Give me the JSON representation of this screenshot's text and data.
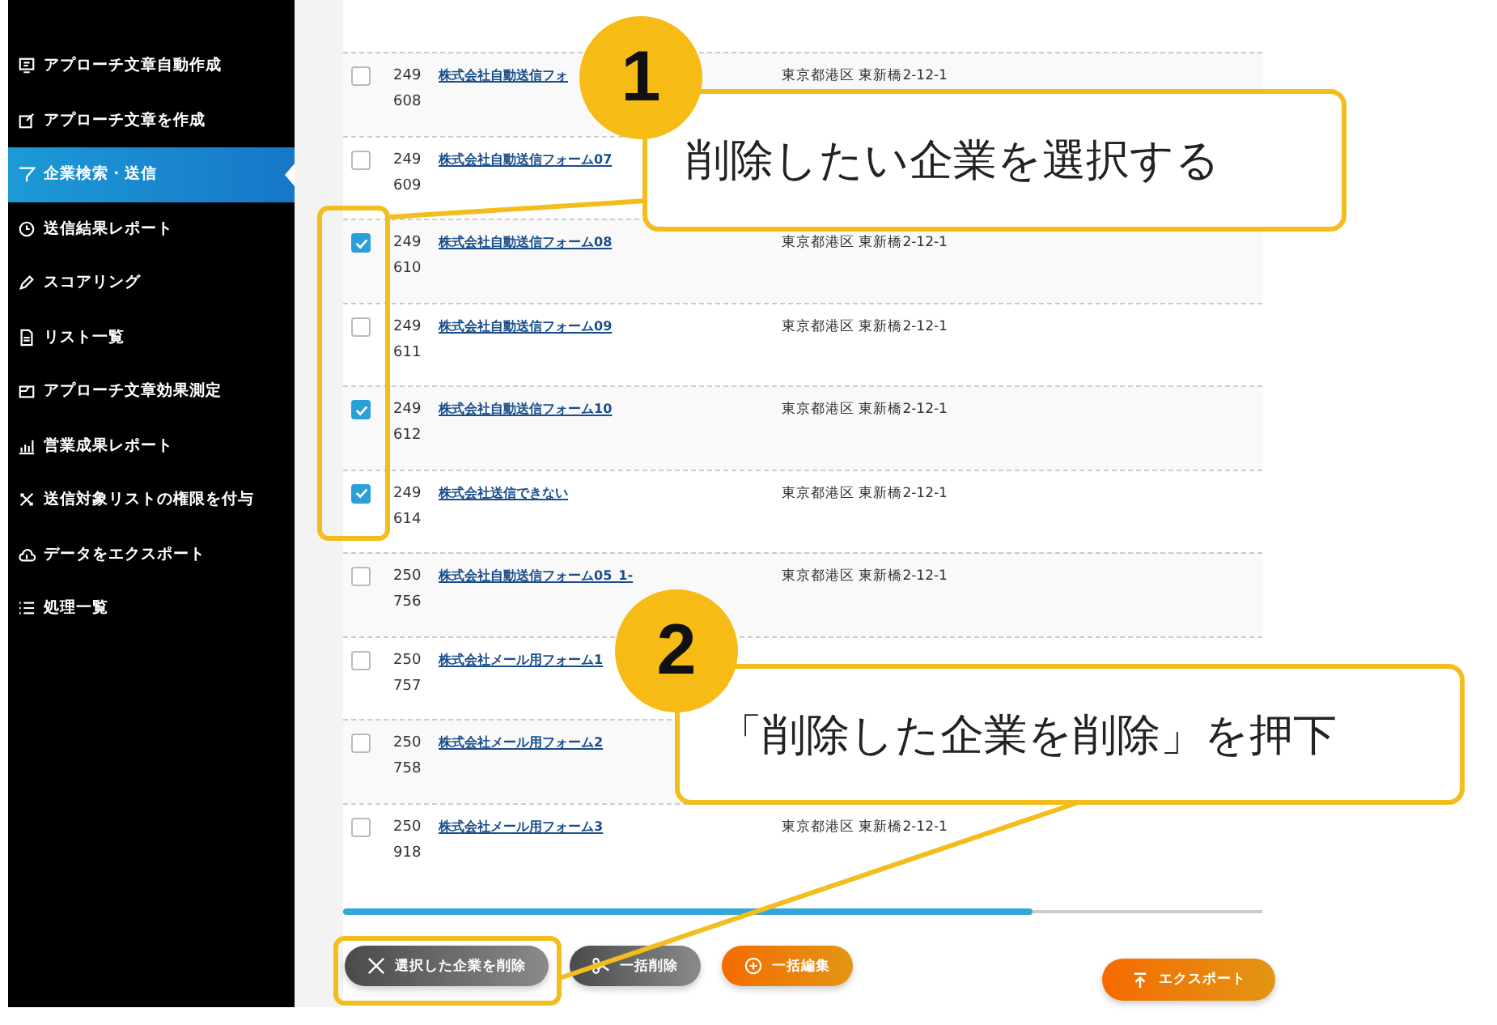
{
  "sidebar": {
    "items": [
      {
        "label": "アプローチ文章自動作成",
        "selected": false
      },
      {
        "label": "アプローチ文章を作成",
        "selected": false
      },
      {
        "label": "企業検索・送信",
        "selected": true
      },
      {
        "label": "送信結果レポート",
        "selected": false
      },
      {
        "label": "スコアリング",
        "selected": false
      },
      {
        "label": "リスト一覧",
        "selected": false
      },
      {
        "label": "アプローチ文章効果測定",
        "selected": false
      },
      {
        "label": "営業成果レポート",
        "selected": false
      },
      {
        "label": "送信対象リストの権限を付与",
        "selected": false
      },
      {
        "label": "データをエクスポート",
        "selected": false
      },
      {
        "label": "処理一覧",
        "selected": false
      }
    ]
  },
  "table": {
    "rows": [
      {
        "checked": false,
        "id": "249608",
        "company": "株式会社自動送信フォ",
        "address": "東京都港区 東新橋2-12-1"
      },
      {
        "checked": false,
        "id": "249609",
        "company": "株式会社自動送信フォーム07"
      },
      {
        "checked": true,
        "id": "249610",
        "company": "株式会社自動送信フォーム08",
        "address": "東京都港区 東新橋2-12-1"
      },
      {
        "checked": false,
        "id": "249611",
        "company": "株式会社自動送信フォーム09",
        "address": "東京都港区 東新橋2-12-1"
      },
      {
        "checked": true,
        "id": "249612",
        "company": "株式会社自動送信フォーム10",
        "address": "東京都港区 東新橋2-12-1"
      },
      {
        "checked": true,
        "id": "249614",
        "company": "株式会社送信できない",
        "address": "東京都港区 東新橋2-12-1"
      },
      {
        "checked": false,
        "id": "250756",
        "company": "株式会社自動送信フォーム05_1-",
        "address": "東京都港区 東新橋2-12-1"
      },
      {
        "checked": false,
        "id": "250757",
        "company": "株式会社メール用フォーム1"
      },
      {
        "checked": false,
        "id": "250758",
        "company": "株式会社メール用フォーム2"
      },
      {
        "checked": false,
        "id": "250918",
        "company": "株式会社メール用フォーム3",
        "address": "東京都港区 東新橋2-12-1"
      }
    ]
  },
  "scrollbar": {
    "level": 0.75
  },
  "actions": [
    {
      "label": "選択した企業を削除",
      "kind": "delete-selected"
    },
    {
      "label": "一括削除",
      "kind": "bulk-delete"
    },
    {
      "label": "一括編集",
      "kind": "bulk-edit"
    }
  ],
  "export_button": {
    "label": "エクスポート"
  },
  "annotations": [
    {
      "number": "1",
      "text": "削除したい企業を選択する"
    },
    {
      "number": "2",
      "text": "「削除した企業を削除」を押下"
    }
  ]
}
